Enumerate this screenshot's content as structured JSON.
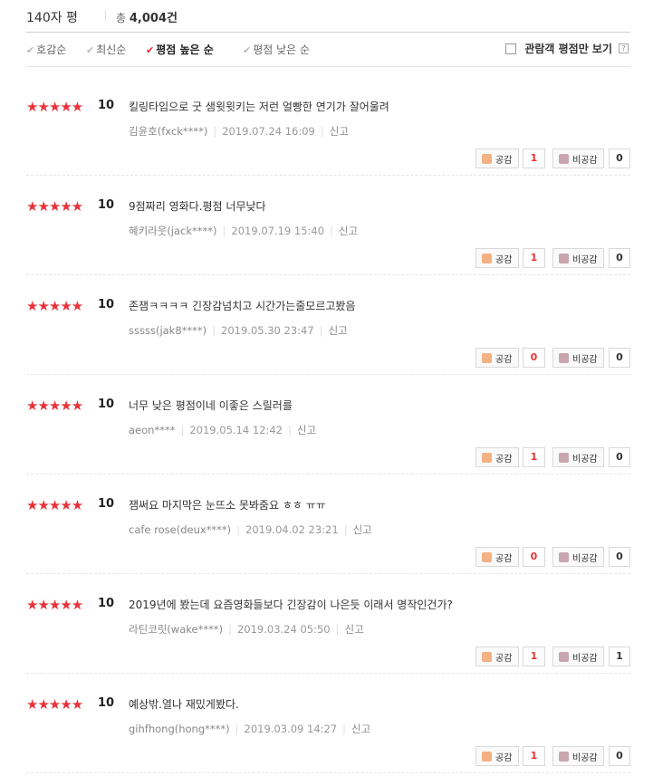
{
  "header": {
    "title": "140자 평",
    "total_prefix": "총",
    "total_count": "4,004",
    "total_suffix": "건"
  },
  "sort": {
    "options": [
      {
        "label": "호감순",
        "active": false
      },
      {
        "label": "최신순",
        "active": false
      },
      {
        "label": "평점 높은 순",
        "active": true
      },
      {
        "label": "평점 낮은 순",
        "active": false
      }
    ],
    "audience_only_label": "관람객 평점만 보기",
    "help": "?"
  },
  "accent_color": "#e8323a",
  "labels": {
    "like": "공감",
    "dislike": "비공감",
    "report": "신고"
  },
  "reviews": [
    {
      "stars": "★★★★★",
      "score": "10",
      "text": "킬링타임으로 굿 샘윗윗키는 저런 얼빵한 연기가 잘어울려",
      "author": "김윤호(fxck****)",
      "date": "2019.07.24 16:09",
      "likes": "1",
      "dislikes": "0"
    },
    {
      "stars": "★★★★★",
      "score": "10",
      "text": "9점짜리 영화다.평점 너무낮다",
      "author": "혜키라웃(jack****)",
      "date": "2019.07.19 15:40",
      "likes": "1",
      "dislikes": "0"
    },
    {
      "stars": "★★★★★",
      "score": "10",
      "text": "존잼ㅋㅋㅋㅋ 긴장감넘치고 시간가는줄모르고봤음",
      "author": "sssss(jak8****)",
      "date": "2019.05.30 23:47",
      "likes": "0",
      "dislikes": "0"
    },
    {
      "stars": "★★★★★",
      "score": "10",
      "text": "너무 낮은 평점이네 이좋은 스릴러를",
      "author": "aeon****",
      "date": "2019.05.14 12:42",
      "likes": "1",
      "dislikes": "0"
    },
    {
      "stars": "★★★★★",
      "score": "10",
      "text": "잼써요 마지막은 눈뜨소 못봐줌요 ㅎㅎ ㅠㅠ",
      "author": "cafe rose(deux****)",
      "date": "2019.04.02 23:21",
      "likes": "0",
      "dislikes": "0"
    },
    {
      "stars": "★★★★★",
      "score": "10",
      "text": "2019년에 봤는데 요즘영화들보다 긴장감이 나은듯 이래서 명작인건가?",
      "author": "라틴코릿(wake****)",
      "date": "2019.03.24 05:50",
      "likes": "1",
      "dislikes": "1"
    },
    {
      "stars": "★★★★★",
      "score": "10",
      "text": "예상밖.열나 재밌게봤다.",
      "author": "gihfhong(hong****)",
      "date": "2019.03.09 14:27",
      "likes": "1",
      "dislikes": "0"
    }
  ]
}
